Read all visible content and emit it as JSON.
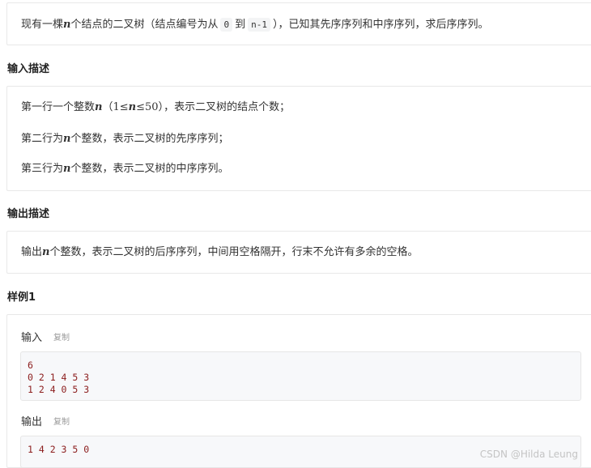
{
  "description": {
    "prefix": "现有一棵",
    "var_n": "n",
    "mid": "个结点的二叉树（结点编号为从",
    "code_start": "0",
    "to": "到",
    "code_end": "n-1",
    "suffix": "），已知其先序序列和中序序列，求后序序列。"
  },
  "input_section": {
    "title": "输入描述",
    "line1": {
      "prefix": "第一行一个整数",
      "var": "n",
      "paren_open": "（",
      "math": "1≤",
      "math_var": "n",
      "math_end": "≤50",
      "paren_close": "）",
      "suffix": "，表示二叉树的结点个数；"
    },
    "line2": {
      "prefix": "第二行为",
      "var": "n",
      "suffix": "个整数，表示二叉树的先序序列；"
    },
    "line3": {
      "prefix": "第三行为",
      "var": "n",
      "suffix": "个整数，表示二叉树的中序序列。"
    }
  },
  "output_section": {
    "title": "输出描述",
    "line1": {
      "prefix": "输出",
      "var": "n",
      "suffix": "个整数，表示二叉树的后序序列，中间用空格隔开，行末不允许有多余的空格。"
    }
  },
  "sample": {
    "title": "样例1",
    "input_label": "输入",
    "output_label": "输出",
    "copy_label": "复制",
    "input_text": "6\n0 2 1 4 5 3\n1 2 4 0 5 3",
    "output_text": "1 4 2 3 5 0"
  },
  "watermark": "CSDN @Hilda Leung"
}
